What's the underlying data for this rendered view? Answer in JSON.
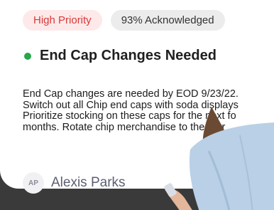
{
  "badges": {
    "priority": "High Priority",
    "acknowledged": "93% Acknowledged"
  },
  "notice": {
    "title": "End Cap Changes Needed",
    "body_lines": [
      "End Cap changes are needed by EOD 9/23/22.",
      "Switch out all Chip end caps with soda displays",
      "Prioritize stocking on these caps for the next fo",
      "months. Rotate chip merchandise to the corr"
    ]
  },
  "author": {
    "initials": "AP",
    "name": "Alexis Parks"
  },
  "colors": {
    "priority_text": "#d83a3a",
    "priority_bg": "#fde9e9",
    "status_dot": "#27a84a"
  }
}
